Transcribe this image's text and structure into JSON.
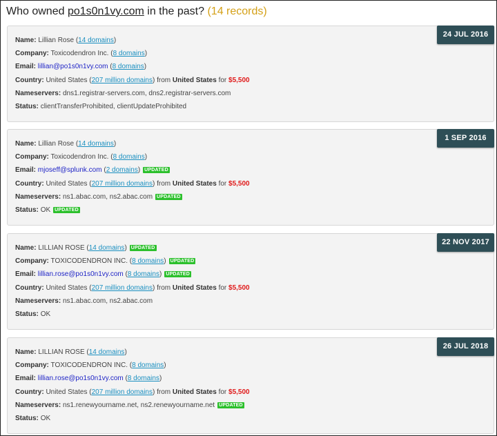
{
  "heading": {
    "prefix": "Who owned",
    "domain": "po1s0n1vy.com",
    "suffix": "in the past?",
    "count": "(14 records)"
  },
  "labels": {
    "name": "Name:",
    "company": "Company:",
    "email": "Email:",
    "country": "Country:",
    "nameservers": "Nameservers:",
    "status": "Status:",
    "from": "from",
    "for": "for",
    "updated": "UPDATED"
  },
  "records": [
    {
      "date": "24 JUL 2016",
      "name": "Lillian Rose",
      "name_domains": "14 domains",
      "company": "Toxicodendron Inc.",
      "company_domains": "8 domains",
      "email": "lillian@po1s0n1vy.com",
      "email_domains": "8 domains",
      "country": "United States",
      "country_domains": "207 million domains",
      "from_country": "United States",
      "price": "$5,500",
      "nameservers": "dns1.registrar-servers.com, dns2.registrar-servers.com",
      "status": "clientTransferProhibited, clientUpdateProhibited"
    },
    {
      "date": "1 SEP 2016",
      "name": "Lillian Rose",
      "name_domains": "14 domains",
      "company": "Toxicodendron Inc.",
      "company_domains": "8 domains",
      "email": "mjoseff@splunk.com",
      "email_domains": "2 domains",
      "country": "United States",
      "country_domains": "207 million domains",
      "from_country": "United States",
      "price": "$5,500",
      "nameservers": "ns1.abac.com, ns2.abac.com",
      "status": "OK"
    },
    {
      "date": "22 NOV 2017",
      "name": "LILLIAN ROSE",
      "name_domains": "14 domains",
      "company": "TOXICODENDRON INC.",
      "company_domains": "8 domains",
      "email": "lillian.rose@po1s0n1vy.com",
      "email_domains": "8 domains",
      "country": "United States",
      "country_domains": "207 million domains",
      "from_country": "United States",
      "price": "$5,500",
      "nameservers": "ns1.abac.com, ns2.abac.com",
      "status": "OK"
    },
    {
      "date": "26 JUL 2018",
      "name": "LILLIAN ROSE",
      "name_domains": "14 domains",
      "company": "TOXICODENDRON INC.",
      "company_domains": "8 domains",
      "email": "lillian.rose@po1s0n1vy.com",
      "email_domains": "8 domains",
      "country": "United States",
      "country_domains": "207 million domains",
      "from_country": "United States",
      "price": "$5,500",
      "nameservers": "ns1.renewyourname.net, ns2.renewyourname.net",
      "status": "OK"
    }
  ],
  "colors": {
    "badge_bg": "#2e4e56",
    "updated_bg": "#2cc02c",
    "price": "#e01b1b",
    "link": "#1a8fc0",
    "record_count": "#d4a017"
  }
}
